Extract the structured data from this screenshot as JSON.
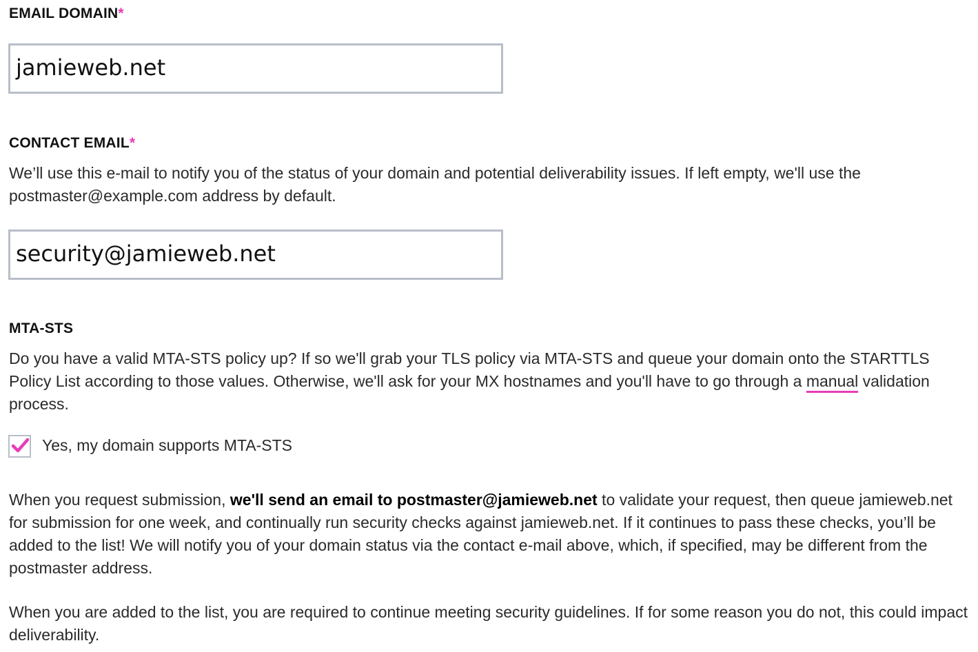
{
  "email_domain": {
    "label": "EMAIL DOMAIN",
    "required_mark": "*",
    "value": "jamieweb.net"
  },
  "contact_email": {
    "label": "CONTACT EMAIL",
    "required_mark": "*",
    "description": "We’ll use this e-mail to notify you of the status of your domain and potential deliverability issues. If left empty, we'll use the postmaster@example.com address by default.",
    "value": "security@jamieweb.net"
  },
  "mta_sts": {
    "label": "MTA-STS",
    "description_before_link": "Do you have a valid MTA-STS policy up? If so we'll grab your TLS policy via MTA-STS and queue your domain onto the STARTTLS Policy List according to those values. Otherwise, we'll ask for your MX hostnames and you'll have to go through a ",
    "link_text": "manual",
    "description_after_link": " validation process.",
    "checkbox_label": "Yes, my domain supports MTA-STS",
    "checkbox_checked": true,
    "check_icon": "checkmark-icon"
  },
  "submission_info": {
    "part1": "When you request submission, ",
    "bold": "we'll send an email to postmaster@jamieweb.net",
    "part2": " to validate your request, then queue jamieweb.net for submission for one week, and continually run security checks against jamieweb.net. If it continues to pass these checks, you’ll be added to the list! We will notify you of your domain status via the contact e-mail above, which, if specified, may be different from the postmaster address."
  },
  "guidelines_info": "When you are added to the list, you are required to continue meeting security guidelines. If for some reason you do not, this could impact deliverability.",
  "colors": {
    "accent": "#e83cb7",
    "input_border": "#b8bec8"
  }
}
